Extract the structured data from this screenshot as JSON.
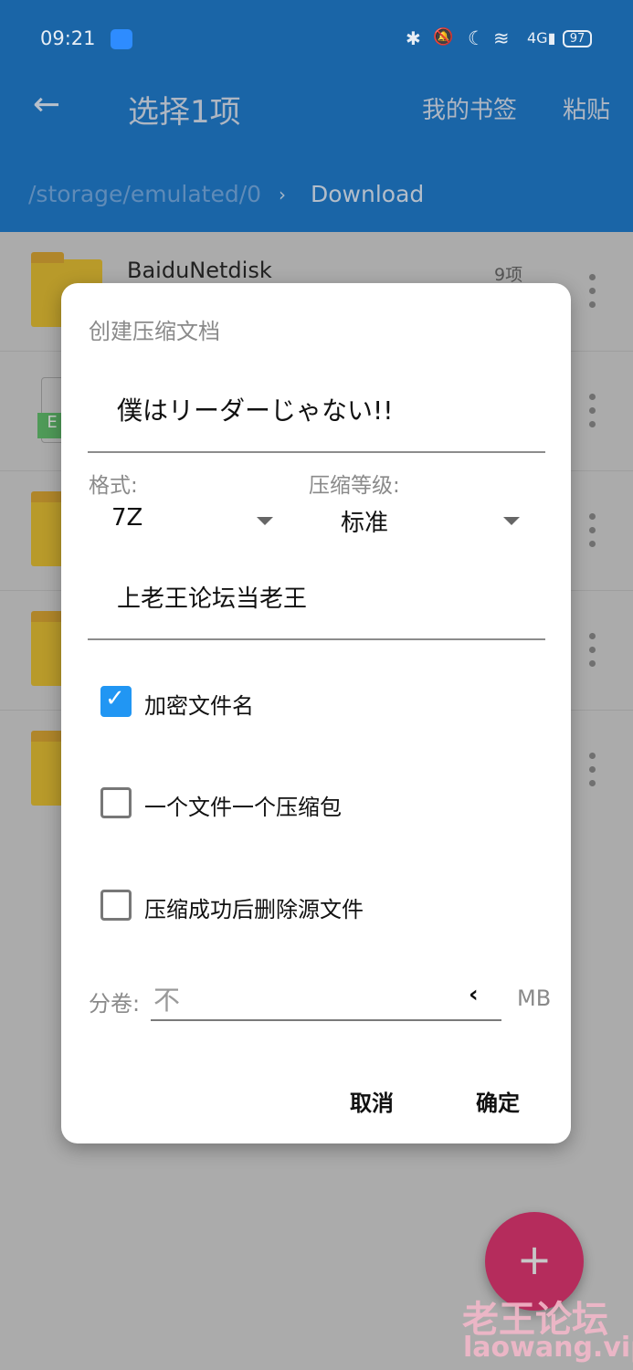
{
  "status_bar": {
    "time": "09:21",
    "battery": "97",
    "icons": [
      "android-icon",
      "bluetooth-icon",
      "mute-icon",
      "moon-icon",
      "wifi-icon",
      "signal-4g-icon",
      "battery-icon"
    ]
  },
  "header": {
    "title": "选择1项",
    "bookmarks": "我的书签",
    "paste": "粘贴",
    "path_root": "/storage/emulated/0",
    "path_current": "Download"
  },
  "files": [
    {
      "name": "BaiduNetdisk",
      "count": "9项"
    }
  ],
  "dialog": {
    "title": "创建压缩文档",
    "archive_name": "僕はリーダーじゃない!!",
    "format_label": "格式:",
    "format_value": "7Z",
    "level_label": "压缩等级:",
    "level_value": "标准",
    "password": "上老王论坛当老王",
    "options": [
      {
        "label": "加密文件名",
        "checked": true
      },
      {
        "label": "一个文件一个压缩包",
        "checked": false
      },
      {
        "label": "压缩成功后删除源文件",
        "checked": false
      }
    ],
    "split_label": "分卷:",
    "split_placeholder": "不",
    "split_unit": "MB",
    "cancel": "取消",
    "ok": "确定"
  },
  "fab": "+",
  "watermark": {
    "cn": "老王论坛",
    "url": "laowang.vip"
  },
  "colors": {
    "header": "#1a65a7",
    "fab": "#b52c5c",
    "checkbox": "#2196f3"
  }
}
